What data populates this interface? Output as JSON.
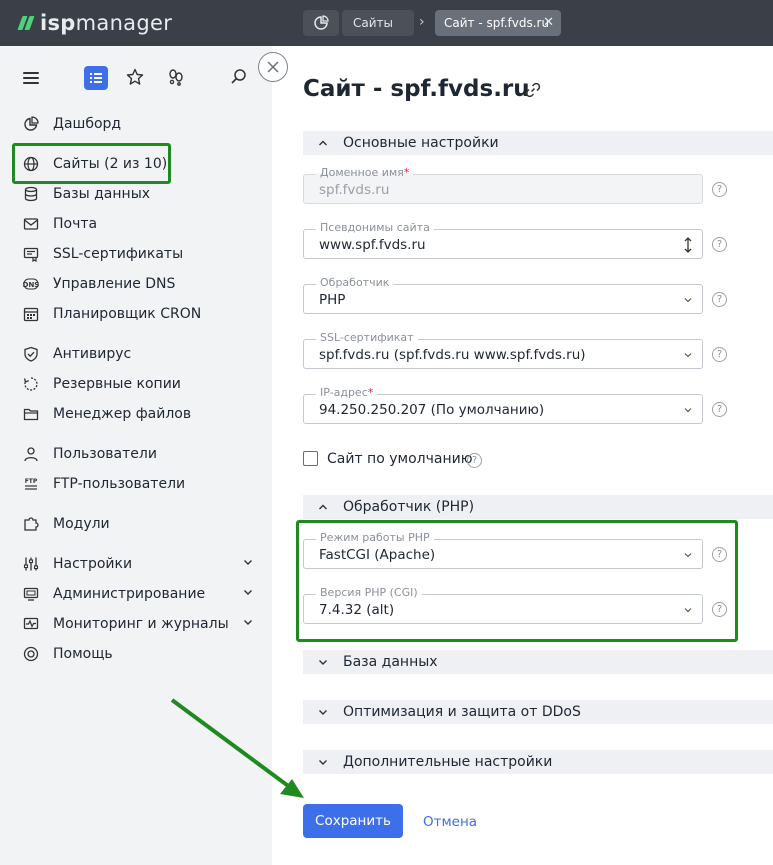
{
  "topbar": {
    "logo_prefix": "isp",
    "logo_suffix": "manager",
    "crumb_sites": "Сайты",
    "crumb_active": "Сайт - spf.fvds.ru"
  },
  "sidebar": {
    "items": [
      {
        "label": "Дашборд"
      },
      {
        "label": "Сайты (2 из 10)"
      },
      {
        "label": "Базы данных"
      },
      {
        "label": "Почта"
      },
      {
        "label": "SSL-сертификаты"
      },
      {
        "label": "Управление DNS"
      },
      {
        "label": "Планировщик CRON"
      },
      {
        "label": "Антивирус"
      },
      {
        "label": "Резервные копии"
      },
      {
        "label": "Менеджер файлов"
      },
      {
        "label": "Пользователи"
      },
      {
        "label": "FTP-пользователи"
      },
      {
        "label": "Модули"
      },
      {
        "label": "Настройки"
      },
      {
        "label": "Администрирование"
      },
      {
        "label": "Мониторинг и журналы"
      },
      {
        "label": "Помощь"
      }
    ]
  },
  "main": {
    "title": "Сайт - spf.fvds.ru",
    "sections": {
      "basic": "Основные настройки",
      "php": "Обработчик (PHP)",
      "db": "База данных",
      "ddos": "Оптимизация и защита от DDoS",
      "extra": "Дополнительные настройки"
    },
    "fields": {
      "domain": {
        "label": "Доменное имя",
        "value": "spf.fvds.ru"
      },
      "aliases": {
        "label": "Псевдонимы сайта",
        "value": "www.spf.fvds.ru"
      },
      "handler": {
        "label": "Обработчик",
        "value": "PHP"
      },
      "ssl": {
        "label": "SSL-сертификат",
        "value": "spf.fvds.ru (spf.fvds.ru www.spf.fvds.ru)"
      },
      "ip": {
        "label": "IP-адрес",
        "value": "94.250.250.207 (По умолчанию)"
      },
      "php_mode": {
        "label": "Режим работы PHP",
        "value": "FastCGI (Apache)"
      },
      "php_version": {
        "label": "Версия PHP (CGI)",
        "value": "7.4.32 (alt)"
      }
    },
    "required_mark": "*",
    "help_glyph": "?",
    "default_site": "Сайт по умолчанию",
    "save_label": "Сохранить",
    "cancel_label": "Отмена"
  },
  "colors": {
    "topbar": "#3b4048",
    "accent": "#3d6fe8",
    "highlight": "#1f8a1f",
    "sidebar": "#f2f3f5"
  }
}
